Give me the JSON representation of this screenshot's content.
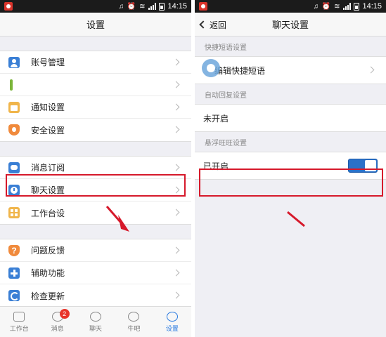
{
  "status": {
    "time": "14:15",
    "signal_icons": "♫ ⏰ 📶"
  },
  "left": {
    "title": "设置",
    "group1": [
      {
        "label": "账号管理",
        "icon": "user-icon"
      },
      {
        "label": "",
        "icon": "green-bar-icon"
      },
      {
        "label": "通知设置",
        "icon": "folder-icon"
      },
      {
        "label": "安全设置",
        "icon": "shield-icon"
      }
    ],
    "group2": [
      {
        "label": "消息订阅",
        "icon": "message-icon"
      },
      {
        "label": "聊天设置",
        "icon": "clock-icon"
      },
      {
        "label": "工作台设",
        "icon": "grid-icon"
      }
    ],
    "group3": [
      {
        "label": "问题反馈",
        "icon": "question-icon"
      },
      {
        "label": "辅助功能",
        "icon": "plus-icon"
      },
      {
        "label": "检查更新",
        "icon": "sync-icon"
      }
    ],
    "tabs": [
      {
        "label": "工作台"
      },
      {
        "label": "消息",
        "badge": "2"
      },
      {
        "label": "聊天"
      },
      {
        "label": "牛吧"
      },
      {
        "label": "设置"
      }
    ]
  },
  "right": {
    "back_label": "返回",
    "title": "聊天设置",
    "section1": "快捷短语设置",
    "row1": "编辑快捷短语",
    "section2": "自动回复设置",
    "row2": "未开启",
    "section3": "悬浮旺旺设置",
    "row3": "已开启"
  },
  "colors": {
    "accent": "#2b7be0",
    "highlight": "#d6192b",
    "toggle": "#2b71c9"
  }
}
